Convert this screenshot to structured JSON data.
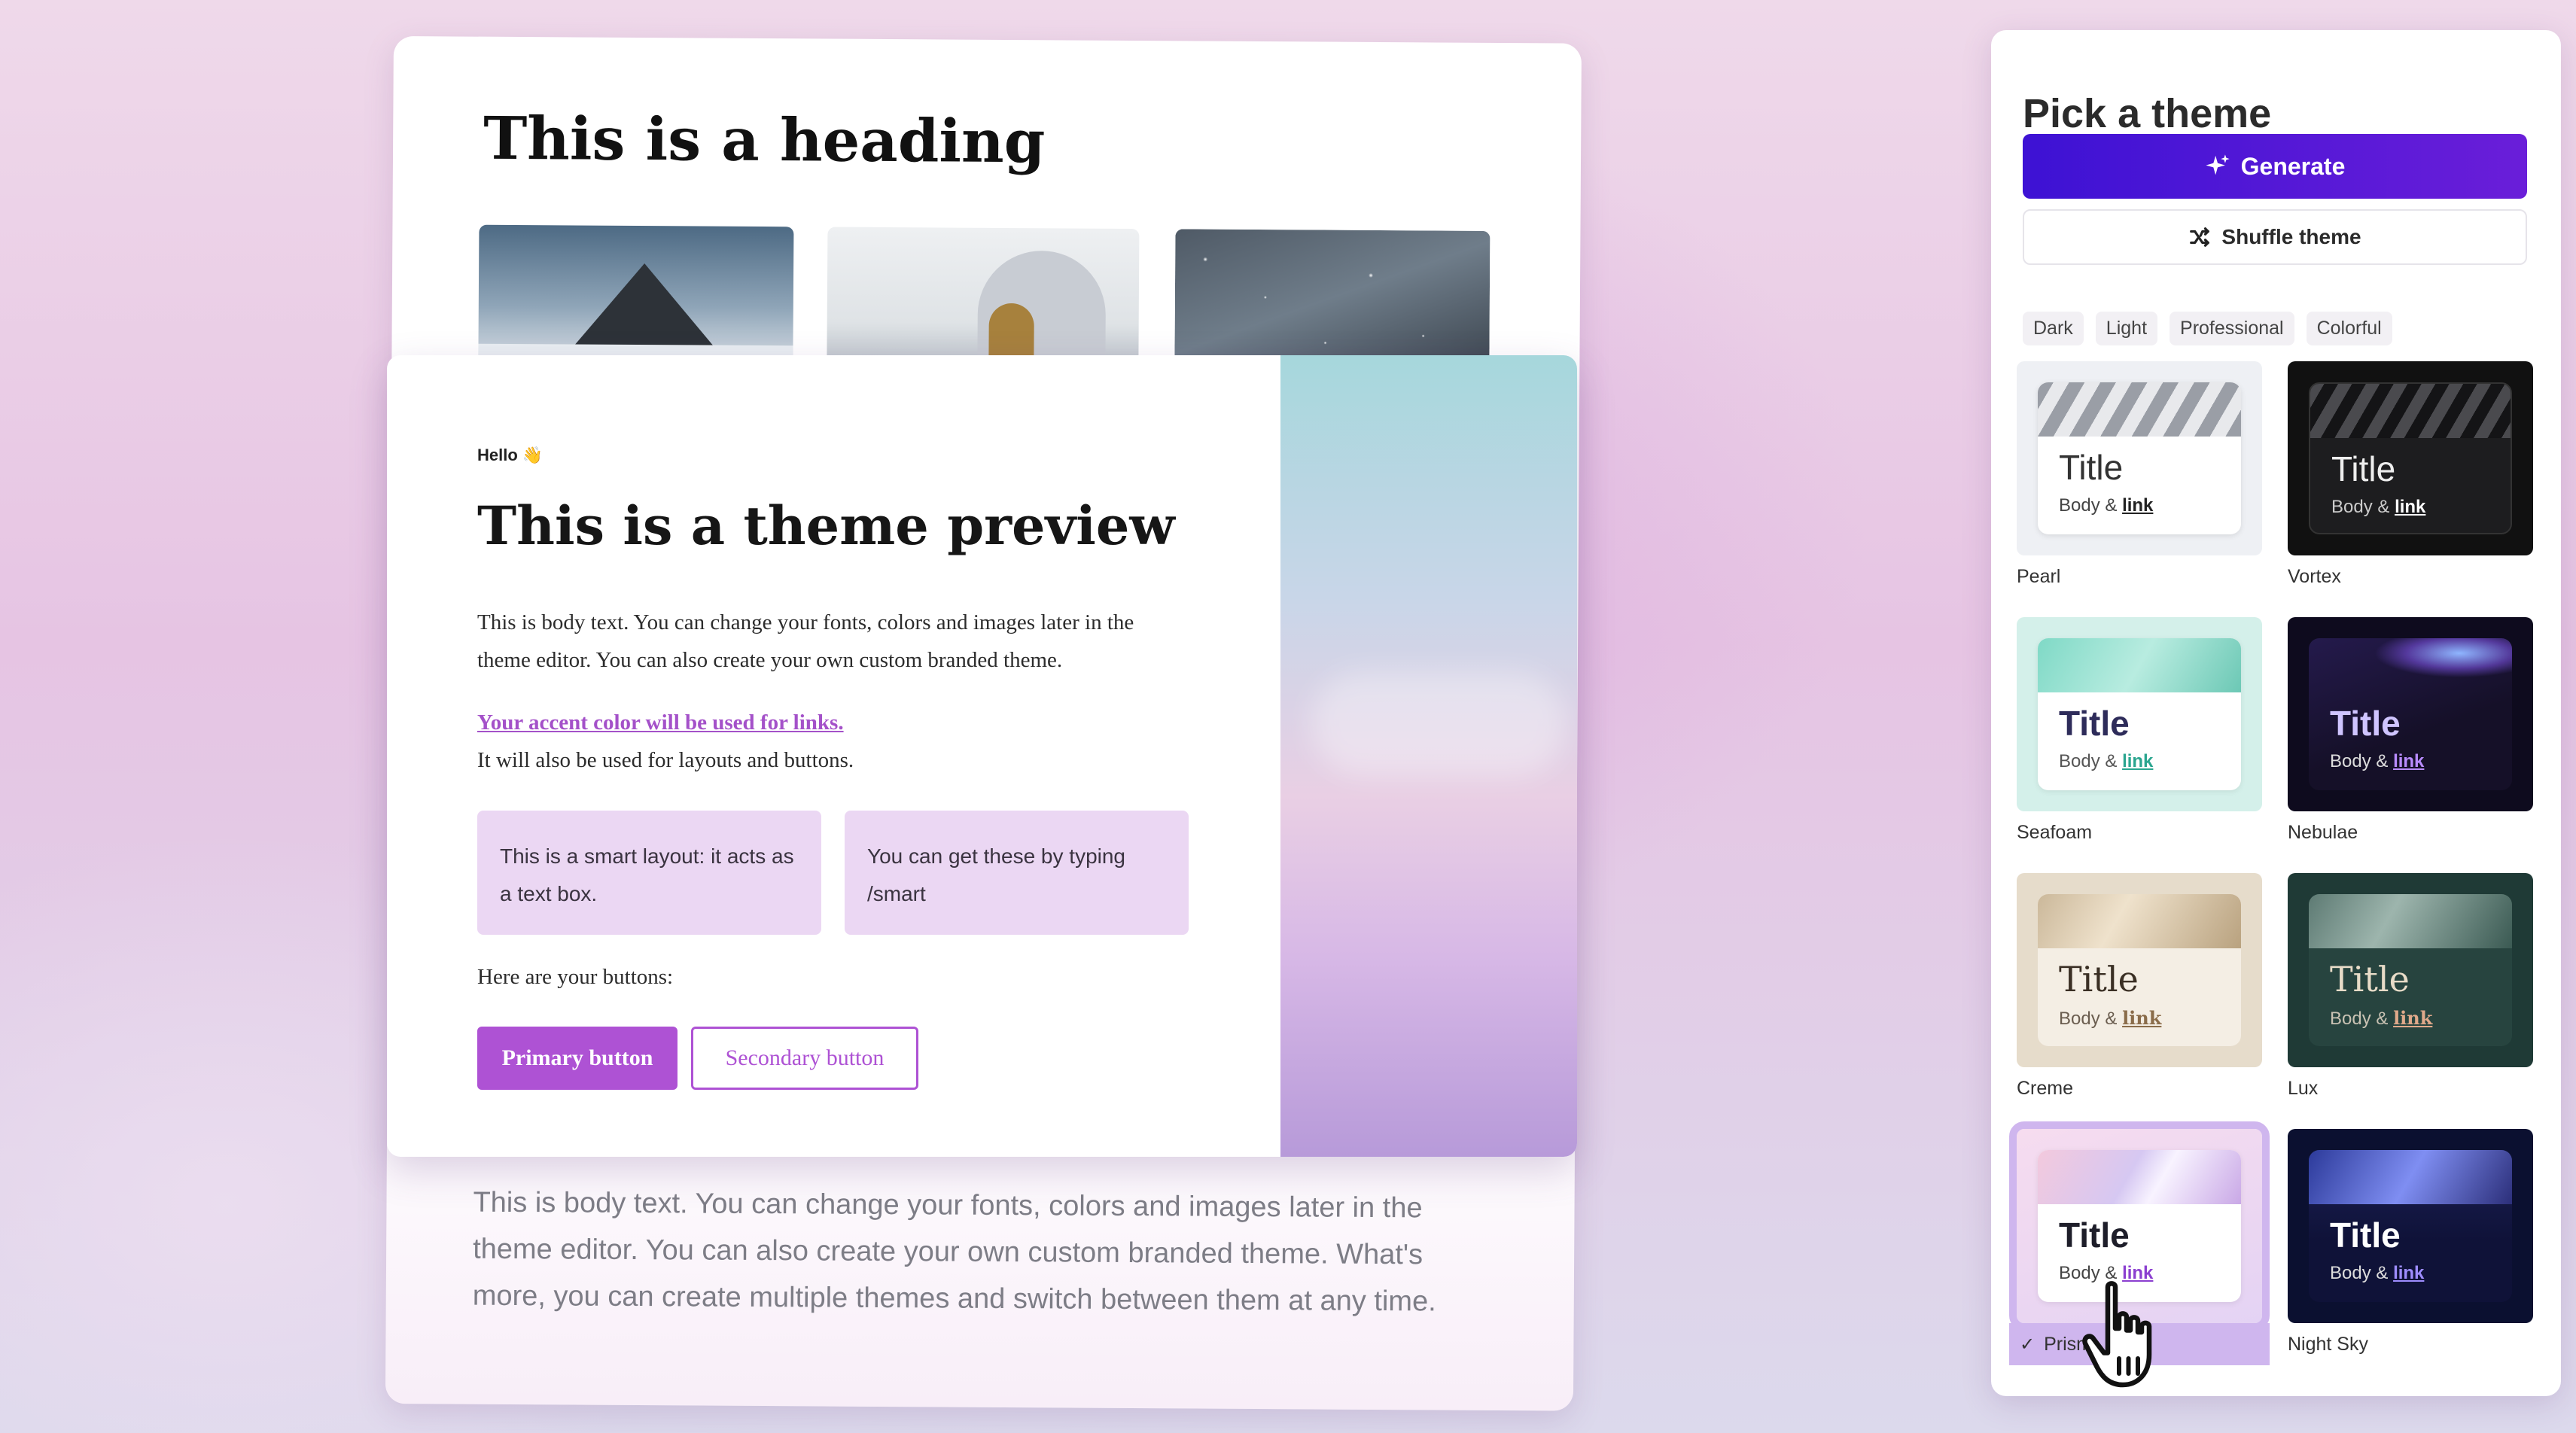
{
  "back_card": {
    "heading": "This is a heading",
    "body": "This is body text. You can change your fonts, colors and images later in the theme editor. You can also create your own custom branded theme. What's more, you can create multiple themes and switch between them at any time."
  },
  "preview": {
    "hello": "Hello 👋",
    "title": "This is a theme preview",
    "body": "This is body text. You can change your fonts, colors and images later in the theme editor. You can also create your own custom branded theme.",
    "accent_link": "Your accent color will be used for links.",
    "accent_sub": "It will also be used for layouts and buttons.",
    "smart_box_1": "This is a smart layout: it acts as a text box.",
    "smart_box_2": "You can get these by typing /smart",
    "buttons_label": "Here are your buttons:",
    "primary_button": "Primary button",
    "secondary_button": "Secondary button",
    "accent_color": "#ae52d4"
  },
  "panel": {
    "title": "Pick a theme",
    "generate_label": "Generate",
    "shuffle_label": "Shuffle theme",
    "filters": [
      "Dark",
      "Light",
      "Professional",
      "Colorful"
    ],
    "theme_title": "Title",
    "theme_body": "Body &",
    "theme_link": "link",
    "themes": [
      {
        "name": "Pearl",
        "selected": false
      },
      {
        "name": "Vortex",
        "selected": false
      },
      {
        "name": "Seafoam",
        "selected": false
      },
      {
        "name": "Nebulae",
        "selected": false
      },
      {
        "name": "Creme",
        "selected": false
      },
      {
        "name": "Lux",
        "selected": false
      },
      {
        "name": "Prism",
        "selected": true
      },
      {
        "name": "Night Sky",
        "selected": false
      }
    ],
    "brand_color": "#3d12d4"
  }
}
